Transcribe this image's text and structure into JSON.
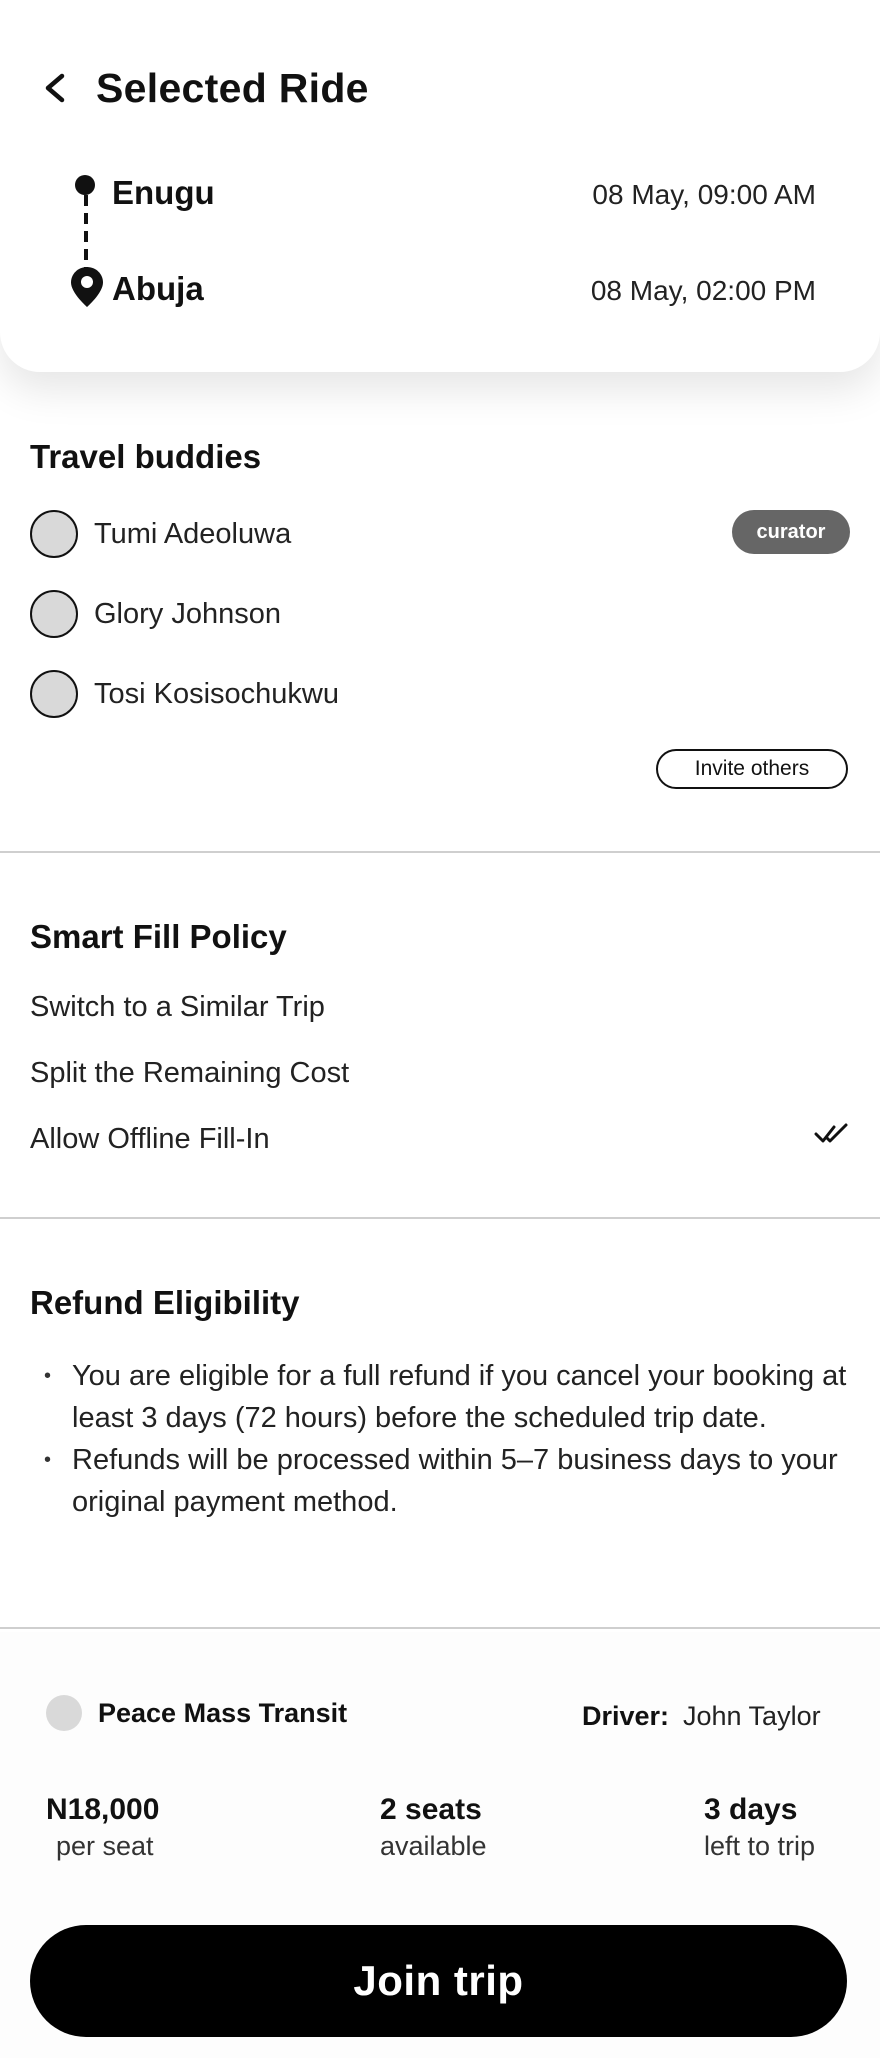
{
  "header": {
    "title": "Selected Ride",
    "route": {
      "origin": {
        "name": "Enugu",
        "time": "08 May, 09:00 AM"
      },
      "destination": {
        "name": "Abuja",
        "time": "08 May, 02:00 PM"
      }
    }
  },
  "buddies": {
    "title": "Travel buddies",
    "items": [
      {
        "name": "Tumi Adeoluwa",
        "badge": "curator"
      },
      {
        "name": "Glory Johnson"
      },
      {
        "name": "Tosi Kosisochukwu"
      }
    ],
    "invite_label": "Invite others"
  },
  "smart_fill": {
    "title": "Smart Fill Policy",
    "options": [
      "Switch to a Similar Trip",
      "Split the Remaining Cost",
      "Allow Offline Fill-In"
    ],
    "selected_index": 2
  },
  "refund": {
    "title": "Refund Eligibility",
    "points": [
      "You are eligible for a full refund if you cancel your booking at least 3 days (72 hours) before the scheduled trip date.",
      "Refunds will be processed within 5–7 business days to your original payment method."
    ]
  },
  "trip": {
    "operator": "Peace Mass Transit",
    "driver_label": "Driver:",
    "driver_name": "John Taylor",
    "price": {
      "value": "N18,000",
      "label": "per seat"
    },
    "seats": {
      "value": "2 seats",
      "label": "available"
    },
    "countdown": {
      "value": "3 days",
      "label": "left to trip"
    }
  },
  "cta": {
    "label": "Join trip"
  }
}
